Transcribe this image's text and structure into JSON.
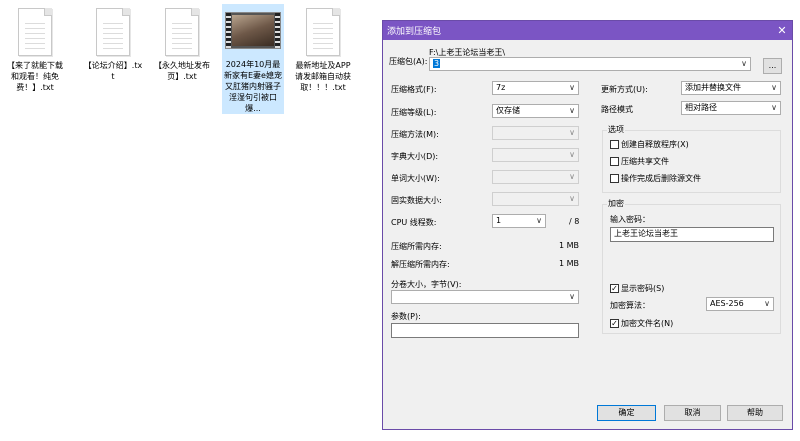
{
  "desktop": {
    "icons": [
      {
        "label": "【来了就能下载和观看！纯免费！】.txt"
      },
      {
        "label": "【论坛介绍】.txt"
      },
      {
        "label": "【永久地址发布页】.txt"
      },
      {
        "label": "2024年10月最新家有E妻e媳宠又肛猪内射骚子淫湿句引被口爆..."
      },
      {
        "label": "最新地址及APP请发邮箱自动获取！！！.txt"
      }
    ]
  },
  "dialog": {
    "title": "添加到压缩包",
    "close": "✕",
    "archive_label": "压缩包(A):",
    "archive_path": "F:\\上老王论坛当老王\\",
    "archive_value": "3",
    "browse": "...",
    "format_label": "压缩格式(F):",
    "format_value": "7z",
    "level_label": "压缩等级(L):",
    "level_value": "仅存储",
    "method_label": "压缩方法(M):",
    "dict_label": "字典大小(D):",
    "word_label": "单词大小(W):",
    "solid_label": "固实数据大小:",
    "cpu_label": "CPU 线程数:",
    "cpu_value": "1",
    "cpu_total": "/ 8",
    "mem_comp_label": "压缩所需内存:",
    "mem_comp_value": "1 MB",
    "mem_decomp_label": "解压缩所需内存:",
    "mem_decomp_value": "1 MB",
    "split_label": "分卷大小，字节(V):",
    "params_label": "参数(P):",
    "update_label": "更新方式(U):",
    "update_value": "添加并替换文件",
    "path_label": "路径模式",
    "path_value": "相对路径",
    "options_title": "选项",
    "opt_sfx": "创建自释放程序(X)",
    "opt_shared": "压缩共享文件",
    "opt_delete": "操作完成后删除源文件",
    "encrypt_title": "加密",
    "password_label": "输入密码：",
    "password_value": "上老王论坛当老王",
    "show_password": "显示密码(S)",
    "enc_method_label": "加密算法：",
    "enc_method_value": "AES-256",
    "encrypt_names": "加密文件名(N)",
    "ok": "确定",
    "cancel": "取消",
    "help": "帮助",
    "arrow": "∨"
  }
}
